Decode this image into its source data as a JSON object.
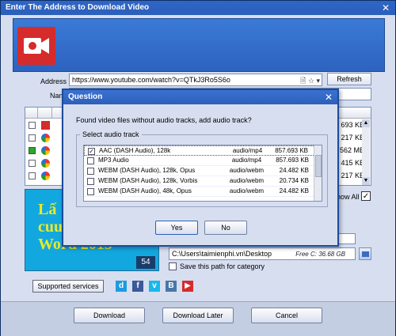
{
  "window": {
    "title": "Enter The Address to Download Video",
    "close": "✕"
  },
  "address": {
    "label": "Address",
    "value": "https://www.youtube.com/watch?v=QTkJ3Ro5S6o",
    "icons": "🗎 ☆ ▾"
  },
  "refresh_label": "Refresh",
  "name_label": "Nam",
  "background_sizes": [
    "693 KB",
    "217 KB",
    "562 MB",
    "415 KB",
    "217 KB"
  ],
  "show_all_label": "how All",
  "show_all_mark": "✓",
  "preview": {
    "line1": "Lấ",
    "line2": "cuu",
    "line3": "Word 2013",
    "number": "54"
  },
  "save_path": {
    "value": "C:\\Users\\taimienphi.vn\\Desktop",
    "free": "Free C: 36.68 GB"
  },
  "save_category_label": "Save this path for category",
  "services_label": "Supported services",
  "service_icons": [
    {
      "label": "d",
      "color": "#1e9be0"
    },
    {
      "label": "f",
      "color": "#3b5998"
    },
    {
      "label": "v",
      "color": "#1ab7ea"
    },
    {
      "label": "B",
      "color": "#4a76a8"
    },
    {
      "label": "▶",
      "color": "#d62b2b"
    }
  ],
  "buttons": {
    "download": "Download",
    "download_later": "Download Later",
    "cancel": "Cancel"
  },
  "dialog": {
    "title": "Question",
    "close": "✕",
    "message": "Found video files without audio tracks, add audio track?",
    "group_label": "Select audio track",
    "tracks": [
      {
        "name": "AAC  (DASH Audio), 128k",
        "format": "audio/mp4",
        "size": "857.693 KB",
        "checked": true
      },
      {
        "name": "MP3  Audio",
        "format": "audio/mp4",
        "size": "857.693 KB",
        "checked": false
      },
      {
        "name": "WEBM (DASH Audio), 128k, Opus",
        "format": "audio/webm",
        "size": "24.482 KB",
        "checked": false
      },
      {
        "name": "WEBM (DASH Audio), 128k, Vorbis",
        "format": "audio/webm",
        "size": "20.734 KB",
        "checked": false
      },
      {
        "name": "WEBM (DASH Audio), 48k, Opus",
        "format": "audio/webm",
        "size": "24.482 KB",
        "checked": false
      }
    ],
    "yes": "Yes",
    "no": "No"
  }
}
